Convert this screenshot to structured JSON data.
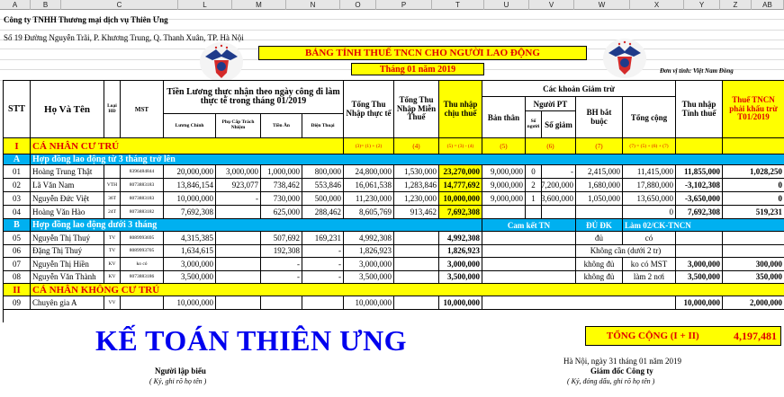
{
  "column_letters": [
    "A",
    "B",
    "C",
    "L",
    "M",
    "N",
    "O",
    "P",
    "T",
    "U",
    "V",
    "W",
    "X",
    "Y",
    "Z",
    "AB"
  ],
  "company": {
    "name": "Công ty TNHH Thương mại dịch vụ Thiên Ưng",
    "address": "Số 19 Đường Nguyễn Trãi, P. Khương Trung, Q. Thanh Xuân, TP. Hà Nội"
  },
  "title": "BẢNG TÍNH THUẾ TNCN CHO NGƯỜI LAO ĐỘNG",
  "month": "Tháng 01 năm 2019",
  "unit": "Đơn vị tính: Việt Nam Đồng",
  "headers": {
    "stt": "STT",
    "name": "Họ Và Tên",
    "loai_hd": "Loại HĐ",
    "mst": "MST",
    "salary_group": "Tiền Lương thực nhận theo ngày công đi làm thực tế trong tháng 01/2019",
    "luong_chinh": "Lương Chính",
    "phu_cap": "Phụ Cấp Trách Nhiệm",
    "tien_an": "Tiền Ăn",
    "dien_thoai": "Điện Thoại",
    "tong_thu_nhap": "Tổng Thu Nhập thực tế",
    "mien_thue": "Tổng Thu Nhập Miễn Thuế",
    "chiu_thue": "Thu nhập chịu thuế",
    "giam_tru": "Các khoản Giảm trừ",
    "ban_than": "Bản thân",
    "nguoi_pt": "Người PT",
    "so_pt": "Số người",
    "so_giam": "Số giảm",
    "bh": "BH bắt buộc",
    "tong_cong": "Tổng cộng",
    "tinh_thue": "Thu nhập Tính thuế",
    "thue_tncn": "Thuế TNCN phải khấu trừ T01/2019"
  },
  "formula_row": {
    "p": "(3)= (1) + (2)",
    "t": "(4)",
    "u": "(5) = (3) - (4)",
    "v": "(5)",
    "w": "(6)",
    "y": "(7)",
    "z": "(7) = (5) + (6) + (7)"
  },
  "sections": {
    "I": {
      "num": "I",
      "label": "CÁ NHÂN CƯ TRÚ"
    },
    "A": {
      "num": "A",
      "label": "Hợp đồng lao động từ 3 tháng trở lên"
    },
    "B": {
      "num": "B",
      "label": "Hợp đồng lao động dưới 3 tháng",
      "cam_ket": "Cam kết TN",
      "du_dk": "ĐỦ ĐK",
      "lam": "Làm 02/CK-TNCN"
    },
    "II": {
      "num": "II",
      "label": "CÁ NHÂN KHÔNG CƯ TRÚ"
    }
  },
  "rows_a": [
    {
      "stt": "01",
      "name": "Hoàng Trung Thật",
      "loai": "",
      "mst": "8396484844",
      "luong": "20,000,000",
      "phucap": "3,000,000",
      "an": "1,000,000",
      "dt": "800,000",
      "tong": "24,800,000",
      "mien": "1,530,000",
      "chiu": "23,270,000",
      "banthan": "9,000,000",
      "nguoi": "0",
      "giam": "-",
      "bh": "2,415,000",
      "cong": "11,415,000",
      "tinh": "11,855,000",
      "thue": "1,028,250"
    },
    {
      "stt": "02",
      "name": "Lã Văn Nam",
      "loai": "VTH",
      "mst": "8073883183",
      "luong": "13,846,154",
      "phucap": "923,077",
      "an": "738,462",
      "dt": "553,846",
      "tong": "16,061,538",
      "mien": "1,283,846",
      "chiu": "14,777,692",
      "banthan": "9,000,000",
      "nguoi": "2",
      "giam": "7,200,000",
      "bh": "1,680,000",
      "cong": "17,880,000",
      "tinh": "-3,102,308",
      "thue": "0"
    },
    {
      "stt": "03",
      "name": "Nguyễn Đức Việt",
      "loai": "36T",
      "mst": "8073883183",
      "luong": "10,000,000",
      "phucap": "-",
      "an": "730,000",
      "dt": "500,000",
      "tong": "11,230,000",
      "mien": "1,230,000",
      "chiu": "10,000,000",
      "banthan": "9,000,000",
      "nguoi": "1",
      "giam": "3,600,000",
      "bh": "1,050,000",
      "cong": "13,650,000",
      "tinh": "-3,650,000",
      "thue": "0"
    },
    {
      "stt": "04",
      "name": "Hoàng Văn Hào",
      "loai": "24T",
      "mst": "8073883182",
      "luong": "7,692,308",
      "phucap": "",
      "an": "625,000",
      "dt": "288,462",
      "tong": "8,605,769",
      "mien": "913,462",
      "chiu": "7,692,308",
      "banthan": "",
      "nguoi": "",
      "giam": "",
      "bh": "",
      "cong": "0",
      "tinh": "7,692,308",
      "thue": "519,231"
    }
  ],
  "rows_b": [
    {
      "stt": "05",
      "name": "Nguyễn Thị Thuý",
      "loai": "TV",
      "mst": "8089993695",
      "luong": "4,315,385",
      "phucap": "",
      "an": "507,692",
      "dt": "169,231",
      "tong": "4,992,308",
      "chiu": "4,992,308",
      "du": "đủ",
      "co": "có",
      "tinh": "",
      "thue": ""
    },
    {
      "stt": "06",
      "name": "Đặng Thị Thuý",
      "loai": "TV",
      "mst": "8089993705",
      "luong": "1,634,615",
      "phucap": "",
      "an": "192,308",
      "dt": "-",
      "tong": "1,826,923",
      "chiu": "1,826,923",
      "du": "Không cần (dưới 2 tr)",
      "co": "",
      "tinh": "",
      "thue": ""
    },
    {
      "stt": "07",
      "name": "Nguyễn Thị Hiền",
      "loai": "KV",
      "mst": "ko có",
      "luong": "3,000,000",
      "phucap": "",
      "an": "-",
      "dt": "-",
      "tong": "3,000,000",
      "chiu": "3,000,000",
      "du": "không đủ",
      "co": "ko có MST",
      "tinh": "3,000,000",
      "thue": "300,000"
    },
    {
      "stt": "08",
      "name": "Nguyễn Văn Thành",
      "loai": "KV",
      "mst": "8073883186",
      "luong": "3,500,000",
      "phucap": "",
      "an": "-",
      "dt": "-",
      "tong": "3,500,000",
      "chiu": "3,500,000",
      "du": "không đủ",
      "co": "làm 2 nơi",
      "tinh": "3,500,000",
      "thue": "350,000"
    }
  ],
  "rows_ii": [
    {
      "stt": "09",
      "name": "Chuyên gia A",
      "loai": "VV",
      "mst": "",
      "luong": "10,000,000",
      "phucap": "",
      "an": "",
      "dt": "",
      "tong": "10,000,000",
      "chiu": "10,000,000",
      "tinh": "10,000,000",
      "thue": "2,000,000"
    }
  ],
  "brand": "KẾ TOÁN THIÊN ƯNG",
  "total_label": "TỔNG CỘNG (I + II)",
  "total_value": "4,197,481",
  "footer": {
    "preparer": "Người lập biểu",
    "preparer_note": "( Ký, ghi rõ họ tên )",
    "date": "Hà Nội, ngày 31 tháng 01 năm 2019",
    "director": "Giám đốc Công ty",
    "director_note": "( Ký, đóng dấu, ghi rõ họ tên )"
  },
  "colors": {
    "yellow": "#ffff00",
    "cyan": "#00b0f0",
    "red": "#e00000",
    "blue": "#0000ee"
  }
}
